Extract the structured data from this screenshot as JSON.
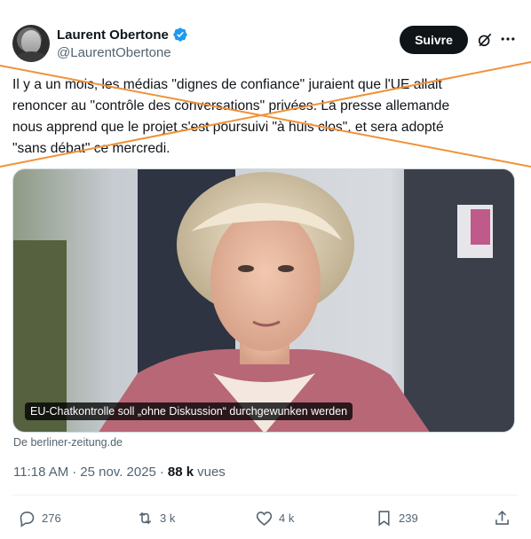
{
  "author": {
    "display_name": "Laurent Obertone",
    "handle": "@LaurentObertone",
    "verified": true,
    "avatar_icon": "avatar-photo"
  },
  "header": {
    "follow_label": "Suivre",
    "grok_icon": "grok-icon",
    "more_icon": "more-icon"
  },
  "tweet": {
    "lines": [
      "Il y a un mois, les médias \"dignes de confiance\" juraient que l'UE allait",
      "renoncer au \"contrôle des conversations\" privées. La presse allemande",
      "nous apprend que le projet s'est poursuivi \"à huis clos\", et sera adopté",
      "\"sans débat\" ce mercredi."
    ],
    "strike_color": "#f0923a"
  },
  "card": {
    "caption": "EU-Chatkontrolle soll „ohne Diskussion“ durchgewunken werden",
    "source": "De berliner-zeitung.de"
  },
  "meta": {
    "time": "11:18 AM",
    "separator": "·",
    "date": "25 nov. 2025",
    "views_count": "88 k",
    "views_label": "vues"
  },
  "actions": {
    "replies": "276",
    "reposts": "3 k",
    "likes": "4 k",
    "bookmarks": "239"
  },
  "colors": {
    "accent": "#1d9bf0",
    "text": "#0f1419",
    "muted": "#536471"
  }
}
